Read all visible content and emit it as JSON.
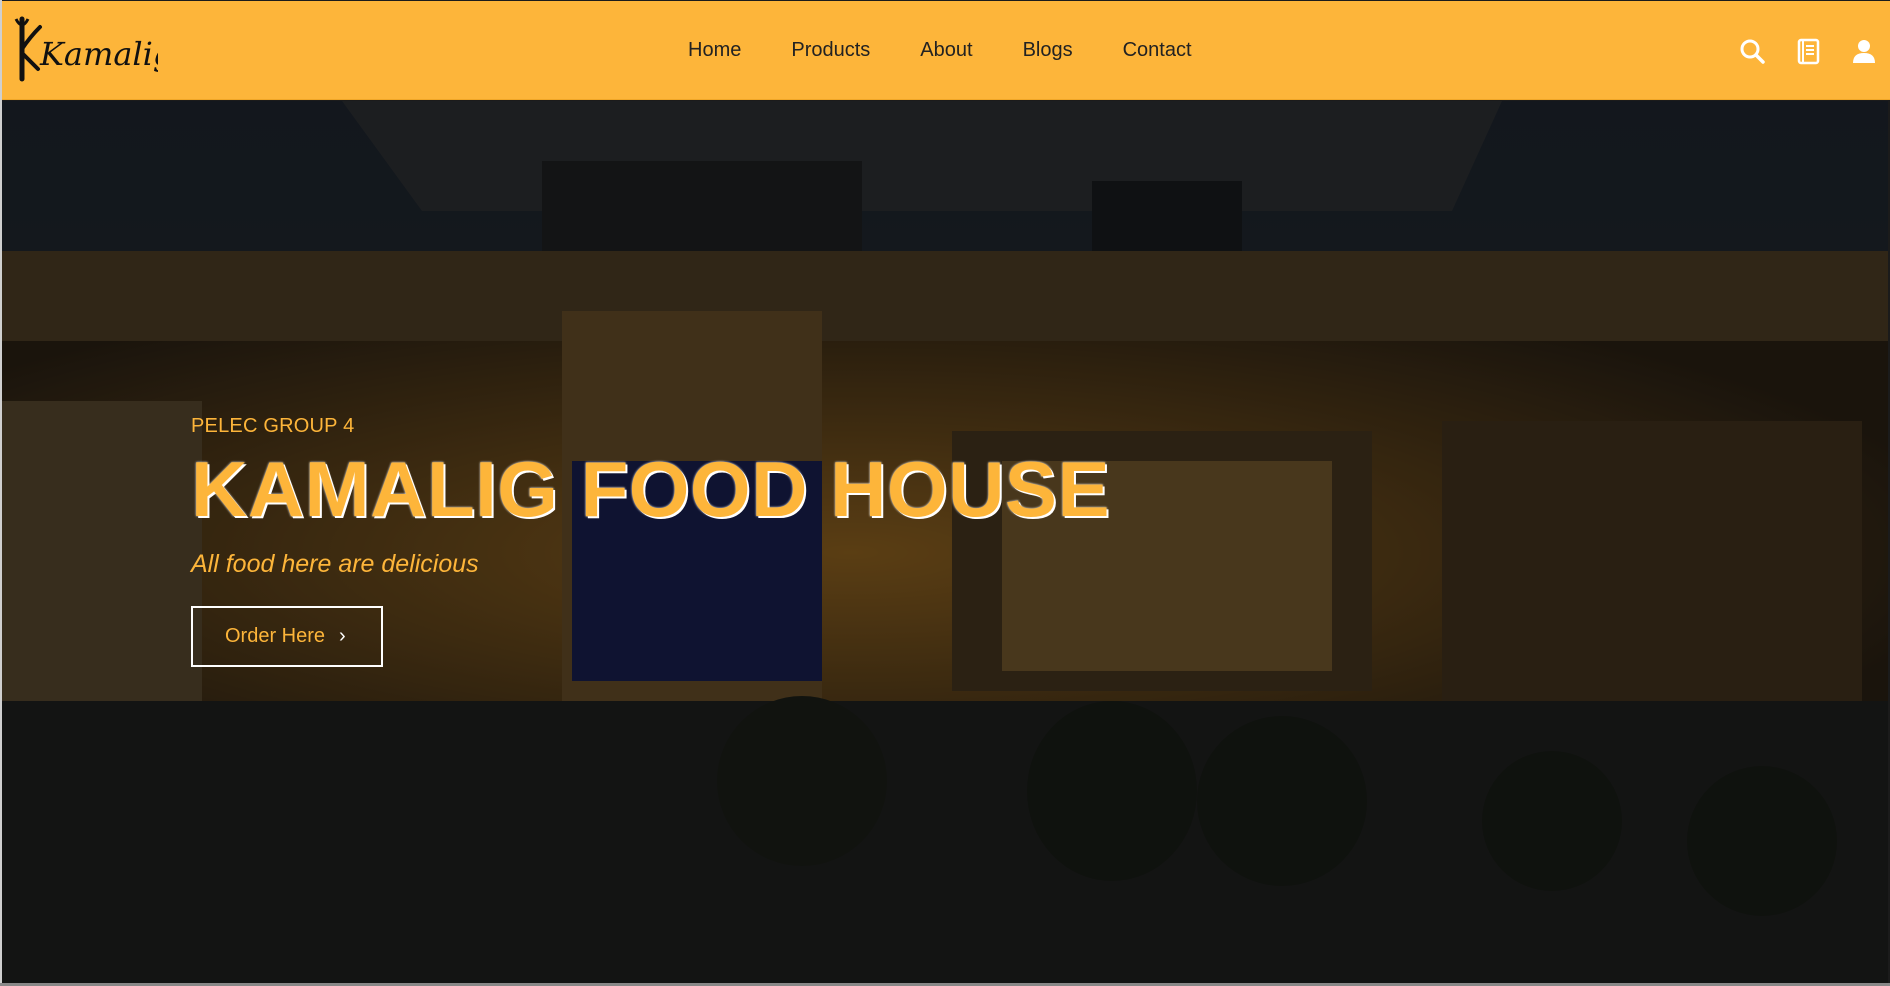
{
  "brand": {
    "logo_text": "Kamalig"
  },
  "nav": {
    "links": [
      {
        "label": "Home"
      },
      {
        "label": "Products"
      },
      {
        "label": "About"
      },
      {
        "label": "Blogs"
      },
      {
        "label": "Contact"
      }
    ],
    "icons": [
      "search-icon",
      "notebook-icon",
      "user-icon"
    ]
  },
  "hero": {
    "kicker": "PELEC GROUP 4",
    "title": "KAMALIG FOOD HOUSE",
    "subtitle": "All food here are delicious",
    "cta_label": "Order Here",
    "cta_chevron": "›"
  },
  "colors": {
    "accent": "#fdb53a",
    "text_dark": "#222222",
    "cta_border": "#ffffff"
  }
}
